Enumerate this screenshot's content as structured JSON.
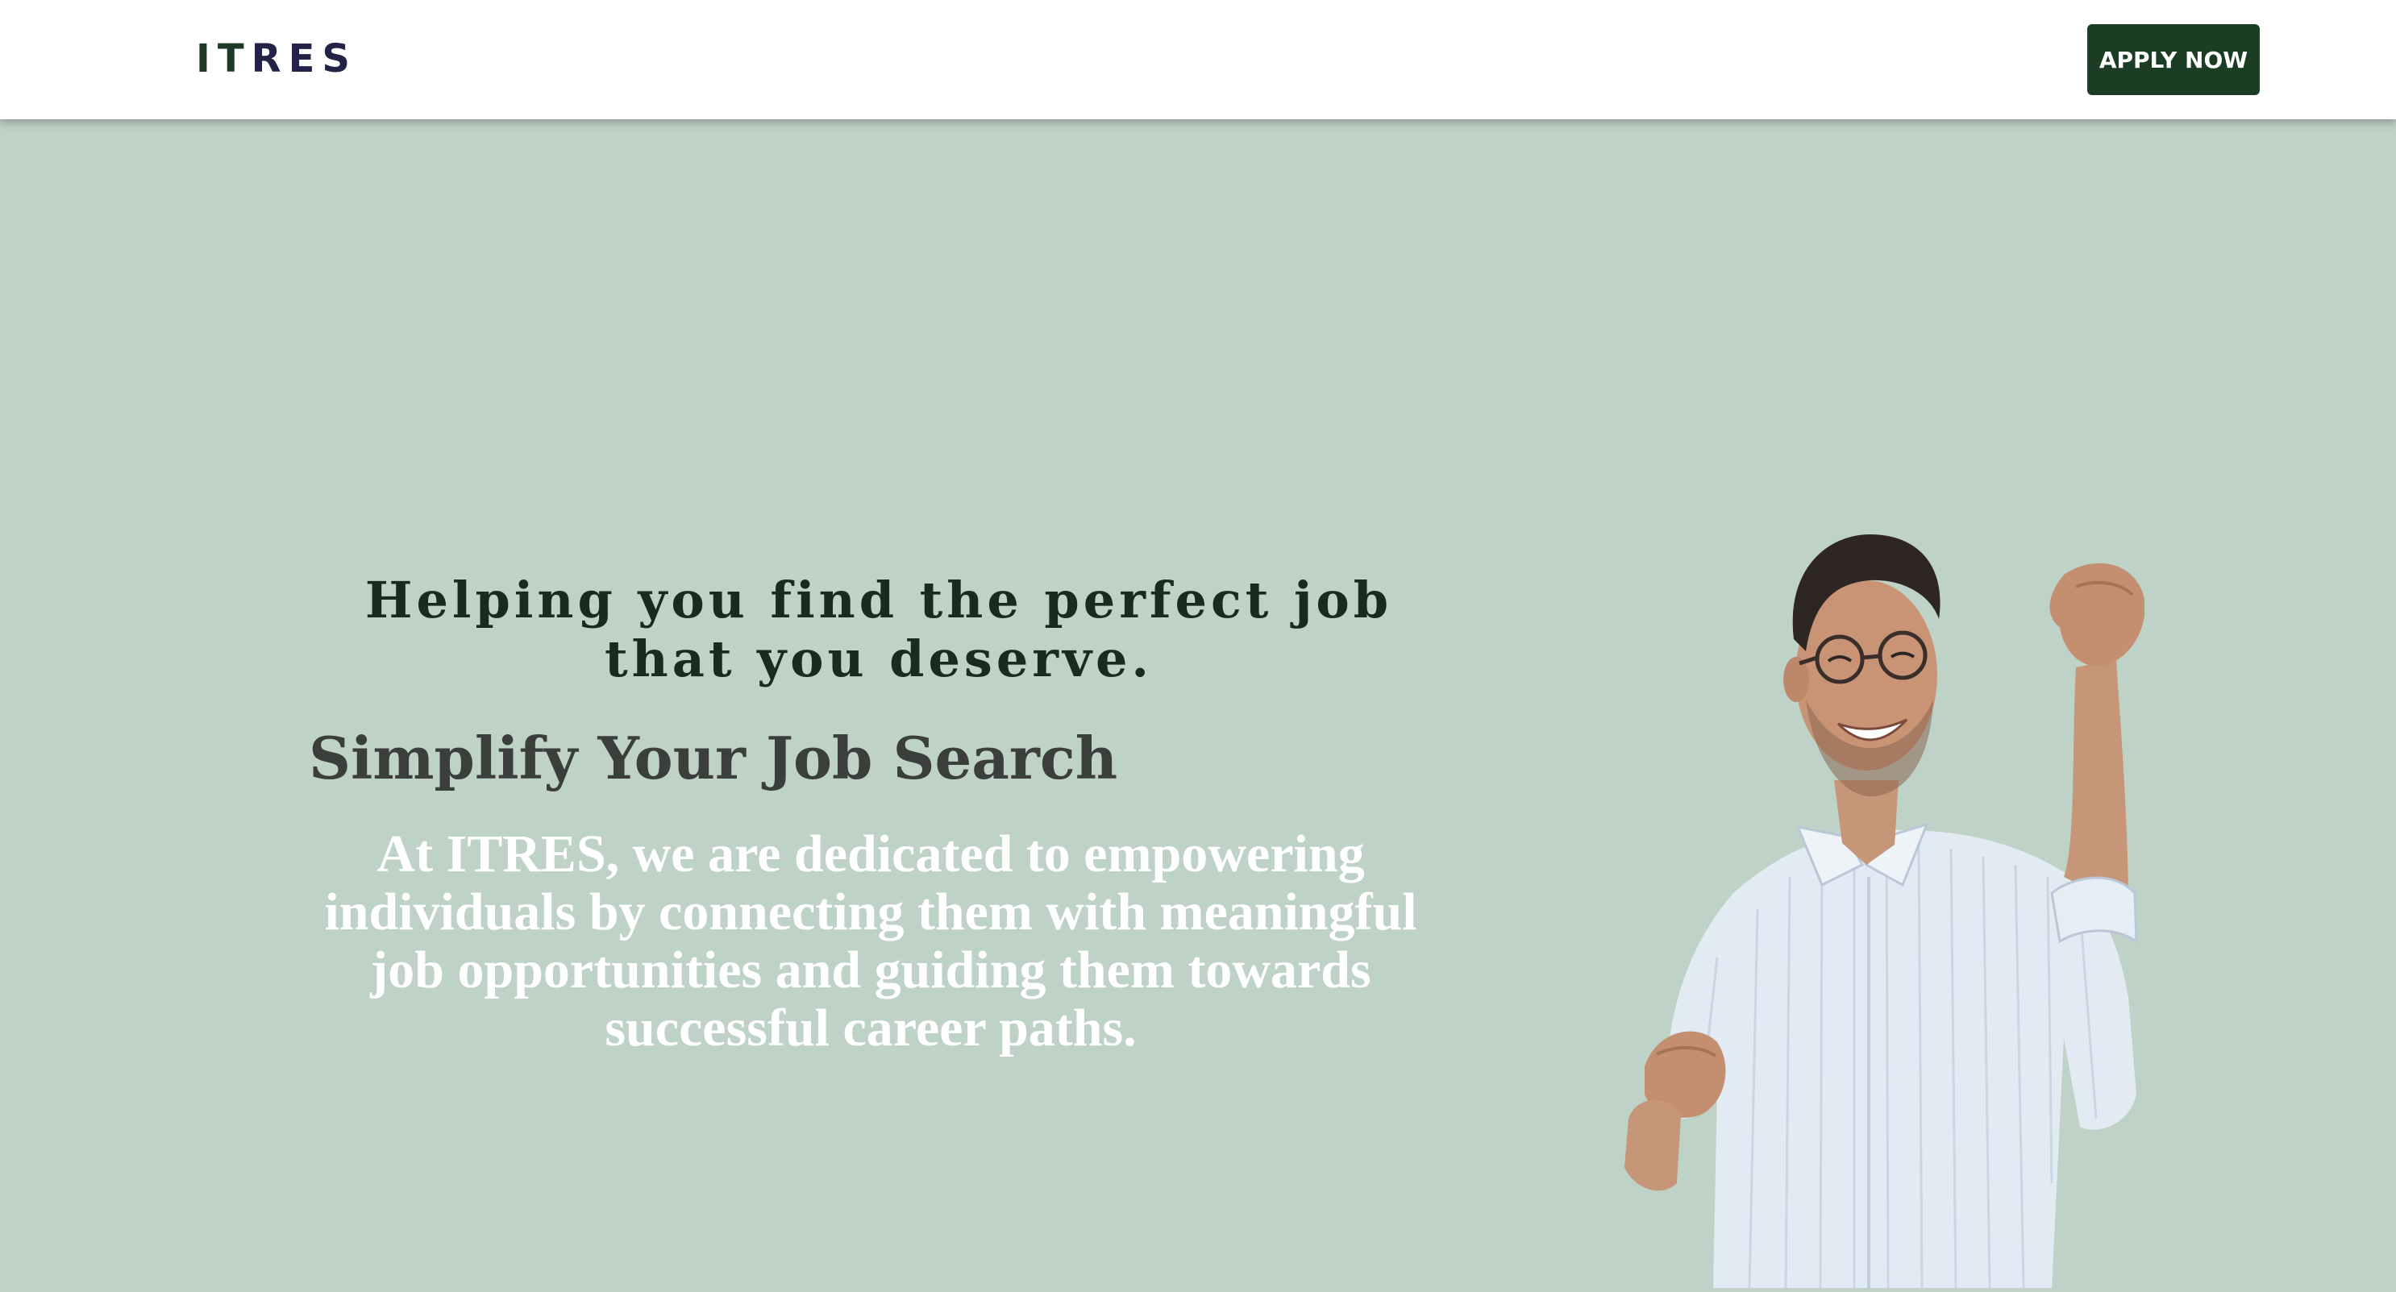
{
  "header": {
    "logo_part1": "IT",
    "logo_part2": "RES",
    "apply_label": "APPLY NOW"
  },
  "hero": {
    "headline": "Helping you find the perfect job that you deserve.",
    "subheadline": "Simplify Your Job Search",
    "description": "At ITRES, we are dedicated to empowering individuals by connecting them with meaningful job opportunities and guiding them towards successful career paths."
  },
  "colors": {
    "hero_background": "#bfd2c7",
    "header_background": "#ffffff",
    "button_background": "#1b3d24",
    "button_text": "#ffffff",
    "headline_text": "#1a2a1e",
    "description_text": "#ffffff"
  }
}
